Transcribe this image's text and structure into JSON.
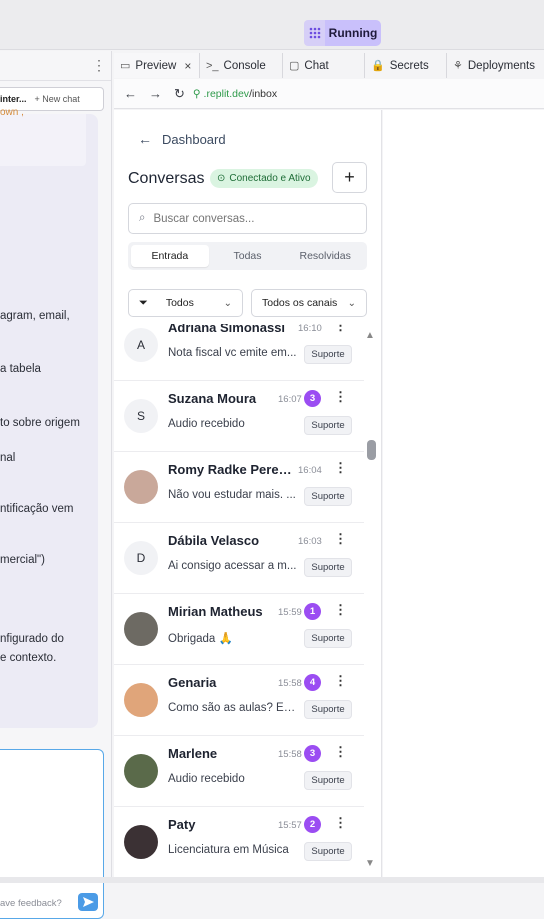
{
  "topbar": {
    "run_label": "Running"
  },
  "left_pane": {
    "subheader_title": "inter...",
    "new_chat_label": "+ New chat",
    "partial_orange": "own ,",
    "lines": [
      "agram, email,",
      "a tabela",
      "to sobre origem",
      "nal",
      "ntificação vem",
      "mercial\")",
      "nfigurado do",
      "e contexto."
    ],
    "feedback_placeholder": "ave feedback?"
  },
  "tabs": [
    {
      "label": "Preview",
      "icon": "monitor-icon",
      "closable": true
    },
    {
      "label": "Console",
      "icon": "terminal-icon"
    },
    {
      "label": "Chat",
      "icon": "chat-icon"
    },
    {
      "label": "Secrets",
      "icon": "lock-icon"
    },
    {
      "label": "Deployments",
      "icon": "deploy-icon"
    }
  ],
  "url": {
    "domain": ".replit.dev",
    "path": "/inbox"
  },
  "app": {
    "back_label": "Dashboard",
    "title": "Conversas",
    "status": "Conectado e Ativo",
    "search_placeholder": "Buscar conversas...",
    "segments": [
      "Entrada",
      "Todas",
      "Resolvidas"
    ],
    "active_segment": "Entrada",
    "filter_status": "Todos",
    "filter_channel": "Todos os canais",
    "conversations": [
      {
        "initial": "A",
        "name": "Adriana Simonassi",
        "time": "16:10",
        "badge": null,
        "preview": "Nota fiscal vc emite em...",
        "tag": "Suporte"
      },
      {
        "initial": "S",
        "name": "Suzana Moura",
        "time": "16:07",
        "badge": "3",
        "preview": "Áudio recebido",
        "tag": "Suporte"
      },
      {
        "initial": "",
        "name": "Romy Radke Pereira",
        "time": "16:04",
        "badge": null,
        "preview": "Não vou estudar mais. ...",
        "tag": "Suporte",
        "photo": "#c9a89a"
      },
      {
        "initial": "D",
        "name": "Dábila Velasco",
        "time": "16:03",
        "badge": null,
        "preview": "Ai consigo acessar a m...",
        "tag": "Suporte"
      },
      {
        "initial": "",
        "name": "Mirian Matheus",
        "time": "15:59",
        "badge": "1",
        "preview": "Obrigada 🙏",
        "tag": "Suporte",
        "photo": "#6d6a63"
      },
      {
        "initial": "",
        "name": "Genaria",
        "time": "15:58",
        "badge": "4",
        "preview": "Como são as aulas? Ess...",
        "tag": "Suporte",
        "photo": "#e0a57a"
      },
      {
        "initial": "",
        "name": "Marlene",
        "time": "15:58",
        "badge": "3",
        "preview": "Áudio recebido",
        "tag": "Suporte",
        "photo": "#5a6a4a"
      },
      {
        "initial": "",
        "name": "Paty",
        "time": "15:57",
        "badge": "2",
        "preview": "Licenciatura em Música",
        "tag": "Suporte",
        "photo": "#3b3134"
      }
    ]
  },
  "colors": {
    "accent_purple": "#9b4df2",
    "status_green": "#daf4e1",
    "run_purple": "#c9c0fb"
  }
}
